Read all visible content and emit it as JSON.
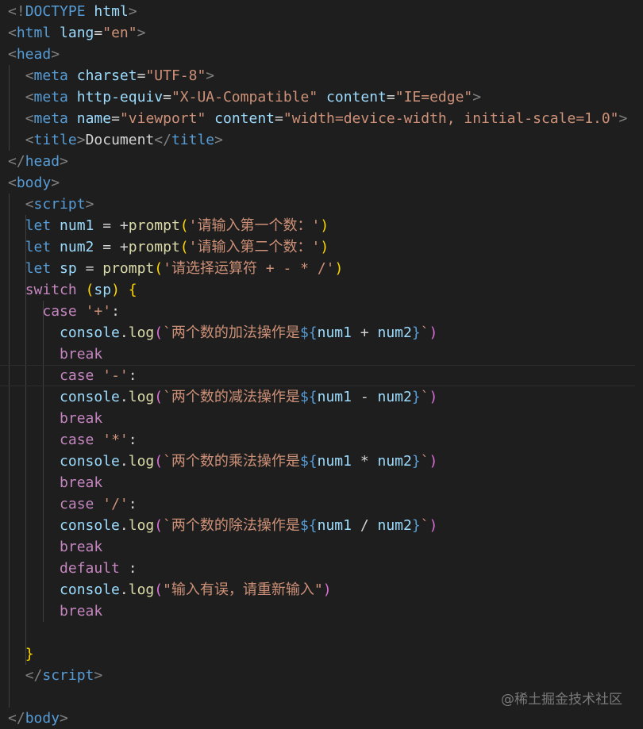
{
  "editor": {
    "theme_colors": {
      "background": "#1e1e1e",
      "tag": "#569cd6",
      "attribute": "#9cdcfe",
      "string": "#ce9178",
      "control_keyword": "#c586c0",
      "function": "#dcdcaa"
    },
    "lines": [
      [
        [
          "t-punct",
          "<!"
        ],
        [
          "t-tag",
          "DOCTYPE"
        ],
        [
          "t-text",
          " "
        ],
        [
          "t-attr",
          "html"
        ],
        [
          "t-punct",
          ">"
        ]
      ],
      [
        [
          "t-punct",
          "<"
        ],
        [
          "t-tag",
          "html"
        ],
        [
          "t-text",
          " "
        ],
        [
          "t-attr",
          "lang"
        ],
        [
          "t-text",
          "="
        ],
        [
          "t-str",
          "\"en\""
        ],
        [
          "t-punct",
          ">"
        ]
      ],
      [
        [
          "t-punct",
          "<"
        ],
        [
          "t-tag",
          "head"
        ],
        [
          "t-punct",
          ">"
        ]
      ],
      [
        [
          "t-text",
          "  "
        ],
        [
          "t-punct",
          "<"
        ],
        [
          "t-tag",
          "meta"
        ],
        [
          "t-text",
          " "
        ],
        [
          "t-attr",
          "charset"
        ],
        [
          "t-text",
          "="
        ],
        [
          "t-str",
          "\"UTF-8\""
        ],
        [
          "t-punct",
          ">"
        ]
      ],
      [
        [
          "t-text",
          "  "
        ],
        [
          "t-punct",
          "<"
        ],
        [
          "t-tag",
          "meta"
        ],
        [
          "t-text",
          " "
        ],
        [
          "t-attr",
          "http-equiv"
        ],
        [
          "t-text",
          "="
        ],
        [
          "t-str",
          "\"X-UA-Compatible\""
        ],
        [
          "t-text",
          " "
        ],
        [
          "t-attr",
          "content"
        ],
        [
          "t-text",
          "="
        ],
        [
          "t-str",
          "\"IE=edge\""
        ],
        [
          "t-punct",
          ">"
        ]
      ],
      [
        [
          "t-text",
          "  "
        ],
        [
          "t-punct",
          "<"
        ],
        [
          "t-tag",
          "meta"
        ],
        [
          "t-text",
          " "
        ],
        [
          "t-attr",
          "name"
        ],
        [
          "t-text",
          "="
        ],
        [
          "t-str",
          "\"viewport\""
        ],
        [
          "t-text",
          " "
        ],
        [
          "t-attr",
          "content"
        ],
        [
          "t-text",
          "="
        ],
        [
          "t-str",
          "\"width=device-width, initial-scale=1.0\""
        ],
        [
          "t-punct",
          ">"
        ]
      ],
      [
        [
          "t-text",
          "  "
        ],
        [
          "t-punct",
          "<"
        ],
        [
          "t-tag",
          "title"
        ],
        [
          "t-punct",
          ">"
        ],
        [
          "t-text",
          "Document"
        ],
        [
          "t-punct",
          "</"
        ],
        [
          "t-tag",
          "title"
        ],
        [
          "t-punct",
          ">"
        ]
      ],
      [
        [
          "t-punct",
          "</"
        ],
        [
          "t-tag",
          "head"
        ],
        [
          "t-punct",
          ">"
        ]
      ],
      [
        [
          "t-punct",
          "<"
        ],
        [
          "t-tag",
          "body"
        ],
        [
          "t-punct",
          ">"
        ]
      ],
      [
        [
          "t-text",
          "  "
        ],
        [
          "t-punct",
          "<"
        ],
        [
          "t-tag",
          "script"
        ],
        [
          "t-punct",
          ">"
        ]
      ],
      [
        [
          "t-text",
          "  "
        ],
        [
          "t-kw",
          "let"
        ],
        [
          "t-text",
          " "
        ],
        [
          "t-var",
          "num1"
        ],
        [
          "t-op",
          " = +"
        ],
        [
          "t-fn",
          "prompt"
        ],
        [
          "t-brace1",
          "("
        ],
        [
          "t-str",
          "'请输入第一个数：'"
        ],
        [
          "t-brace1",
          ")"
        ]
      ],
      [
        [
          "t-text",
          "  "
        ],
        [
          "t-kw",
          "let"
        ],
        [
          "t-text",
          " "
        ],
        [
          "t-var",
          "num2"
        ],
        [
          "t-op",
          " = +"
        ],
        [
          "t-fn",
          "prompt"
        ],
        [
          "t-brace1",
          "("
        ],
        [
          "t-str",
          "'请输入第二个数：'"
        ],
        [
          "t-brace1",
          ")"
        ]
      ],
      [
        [
          "t-text",
          "  "
        ],
        [
          "t-kw",
          "let"
        ],
        [
          "t-text",
          " "
        ],
        [
          "t-var",
          "sp"
        ],
        [
          "t-op",
          " = "
        ],
        [
          "t-fn",
          "prompt"
        ],
        [
          "t-brace1",
          "("
        ],
        [
          "t-str",
          "'请选择运算符 + - * /'"
        ],
        [
          "t-brace1",
          ")"
        ]
      ],
      [
        [
          "t-text",
          "  "
        ],
        [
          "t-ctrl",
          "switch"
        ],
        [
          "t-text",
          " "
        ],
        [
          "t-brace1",
          "("
        ],
        [
          "t-var",
          "sp"
        ],
        [
          "t-brace1",
          ")"
        ],
        [
          "t-text",
          " "
        ],
        [
          "t-brace1",
          "{"
        ]
      ],
      [
        [
          "t-text",
          "    "
        ],
        [
          "t-ctrl",
          "case"
        ],
        [
          "t-text",
          " "
        ],
        [
          "t-str",
          "'+'"
        ],
        [
          "t-text",
          ":"
        ]
      ],
      [
        [
          "t-text",
          "      "
        ],
        [
          "t-obj",
          "console"
        ],
        [
          "t-text",
          "."
        ],
        [
          "t-fn",
          "log"
        ],
        [
          "t-brace2",
          "("
        ],
        [
          "t-str",
          "`两个数的加法操作是"
        ],
        [
          "t-kw",
          "${"
        ],
        [
          "t-var",
          "num1"
        ],
        [
          "t-op",
          " + "
        ],
        [
          "t-var",
          "num2"
        ],
        [
          "t-kw",
          "}"
        ],
        [
          "t-str",
          "`"
        ],
        [
          "t-brace2",
          ")"
        ]
      ],
      [
        [
          "t-text",
          "      "
        ],
        [
          "t-ctrl",
          "break"
        ]
      ],
      [
        [
          "t-text",
          "      "
        ],
        [
          "t-ctrl",
          "case"
        ],
        [
          "t-text",
          " "
        ],
        [
          "t-str",
          "'-'"
        ],
        [
          "t-text",
          ":"
        ]
      ],
      [
        [
          "t-text",
          "      "
        ],
        [
          "t-obj",
          "console"
        ],
        [
          "t-text",
          "."
        ],
        [
          "t-fn",
          "log"
        ],
        [
          "t-brace2",
          "("
        ],
        [
          "t-str",
          "`两个数的减法操作是"
        ],
        [
          "t-kw",
          "${"
        ],
        [
          "t-var",
          "num1"
        ],
        [
          "t-op",
          " - "
        ],
        [
          "t-var",
          "num2"
        ],
        [
          "t-kw",
          "}"
        ],
        [
          "t-str",
          "`"
        ],
        [
          "t-brace2",
          ")"
        ]
      ],
      [
        [
          "t-text",
          "      "
        ],
        [
          "t-ctrl",
          "break"
        ]
      ],
      [
        [
          "t-text",
          "      "
        ],
        [
          "t-ctrl",
          "case"
        ],
        [
          "t-text",
          " "
        ],
        [
          "t-str",
          "'*'"
        ],
        [
          "t-text",
          ":"
        ]
      ],
      [
        [
          "t-text",
          "      "
        ],
        [
          "t-obj",
          "console"
        ],
        [
          "t-text",
          "."
        ],
        [
          "t-fn",
          "log"
        ],
        [
          "t-brace2",
          "("
        ],
        [
          "t-str",
          "`两个数的乘法操作是"
        ],
        [
          "t-kw",
          "${"
        ],
        [
          "t-var",
          "num1"
        ],
        [
          "t-op",
          " * "
        ],
        [
          "t-var",
          "num2"
        ],
        [
          "t-kw",
          "}"
        ],
        [
          "t-str",
          "`"
        ],
        [
          "t-brace2",
          ")"
        ]
      ],
      [
        [
          "t-text",
          "      "
        ],
        [
          "t-ctrl",
          "break"
        ]
      ],
      [
        [
          "t-text",
          "      "
        ],
        [
          "t-ctrl",
          "case"
        ],
        [
          "t-text",
          " "
        ],
        [
          "t-str",
          "'/'"
        ],
        [
          "t-text",
          ":"
        ]
      ],
      [
        [
          "t-text",
          "      "
        ],
        [
          "t-obj",
          "console"
        ],
        [
          "t-text",
          "."
        ],
        [
          "t-fn",
          "log"
        ],
        [
          "t-brace2",
          "("
        ],
        [
          "t-str",
          "`两个数的除法操作是"
        ],
        [
          "t-kw",
          "${"
        ],
        [
          "t-var",
          "num1"
        ],
        [
          "t-op",
          " / "
        ],
        [
          "t-var",
          "num2"
        ],
        [
          "t-kw",
          "}"
        ],
        [
          "t-str",
          "`"
        ],
        [
          "t-brace2",
          ")"
        ]
      ],
      [
        [
          "t-text",
          "      "
        ],
        [
          "t-ctrl",
          "break"
        ]
      ],
      [
        [
          "t-text",
          "      "
        ],
        [
          "t-ctrl",
          "default"
        ],
        [
          "t-text",
          " :"
        ]
      ],
      [
        [
          "t-text",
          "      "
        ],
        [
          "t-obj",
          "console"
        ],
        [
          "t-text",
          "."
        ],
        [
          "t-fn",
          "log"
        ],
        [
          "t-brace2",
          "("
        ],
        [
          "t-str",
          "\"输入有误，请重新输入\""
        ],
        [
          "t-brace2",
          ")"
        ]
      ],
      [
        [
          "t-text",
          "      "
        ],
        [
          "t-ctrl",
          "break"
        ]
      ],
      [
        [
          "t-text",
          ""
        ]
      ],
      [
        [
          "t-text",
          "  "
        ],
        [
          "t-brace1",
          "}"
        ]
      ],
      [
        [
          "t-text",
          "  "
        ],
        [
          "t-punct",
          "</"
        ],
        [
          "t-tag",
          "script"
        ],
        [
          "t-punct",
          ">"
        ]
      ],
      [
        [
          "t-text",
          ""
        ]
      ],
      [
        [
          "t-punct",
          "</"
        ],
        [
          "t-tag",
          "body"
        ],
        [
          "t-punct",
          ">"
        ]
      ]
    ],
    "current_line_index": 17
  },
  "watermark": "@稀土掘金技术社区"
}
